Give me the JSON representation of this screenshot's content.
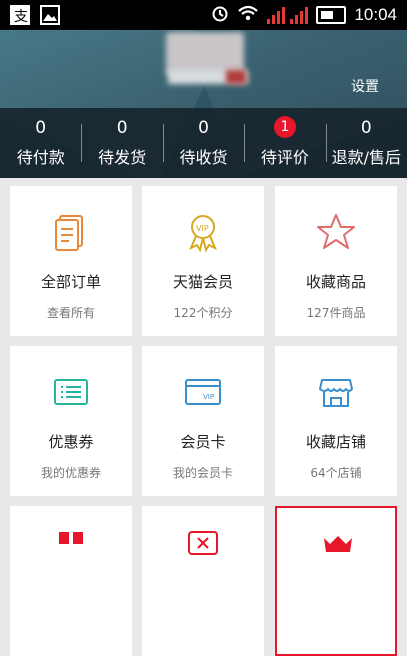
{
  "status_bar": {
    "time": "10:04",
    "icons": [
      "alipay-icon",
      "gallery-icon",
      "alarm-icon",
      "wifi-icon",
      "signal-icon",
      "battery-icon"
    ]
  },
  "header": {
    "settings_label": "设置"
  },
  "orders": [
    {
      "count": "0",
      "label": "待付款"
    },
    {
      "count": "0",
      "label": "待发货"
    },
    {
      "count": "0",
      "label": "待收货"
    },
    {
      "count": "1",
      "label": "待评价"
    },
    {
      "count": "0",
      "label": "退款/售后"
    }
  ],
  "grid": [
    {
      "title": "全部订单",
      "subtitle": "查看所有",
      "icon": "order-list-icon"
    },
    {
      "title": "天猫会员",
      "subtitle": "122个积分",
      "icon": "vip-medal-icon"
    },
    {
      "title": "收藏商品",
      "subtitle": "127件商品",
      "icon": "star-icon"
    },
    {
      "title": "优惠券",
      "subtitle": "我的优惠券",
      "icon": "coupon-icon"
    },
    {
      "title": "会员卡",
      "subtitle": "我的会员卡",
      "icon": "vip-card-icon"
    },
    {
      "title": "收藏店铺",
      "subtitle": "64个店铺",
      "icon": "store-icon"
    }
  ],
  "colors": {
    "accent_red": "#e8162a",
    "orange": "#e8883a",
    "gold": "#d9a820",
    "teal": "#27b39a",
    "blue": "#3a8fcf"
  }
}
